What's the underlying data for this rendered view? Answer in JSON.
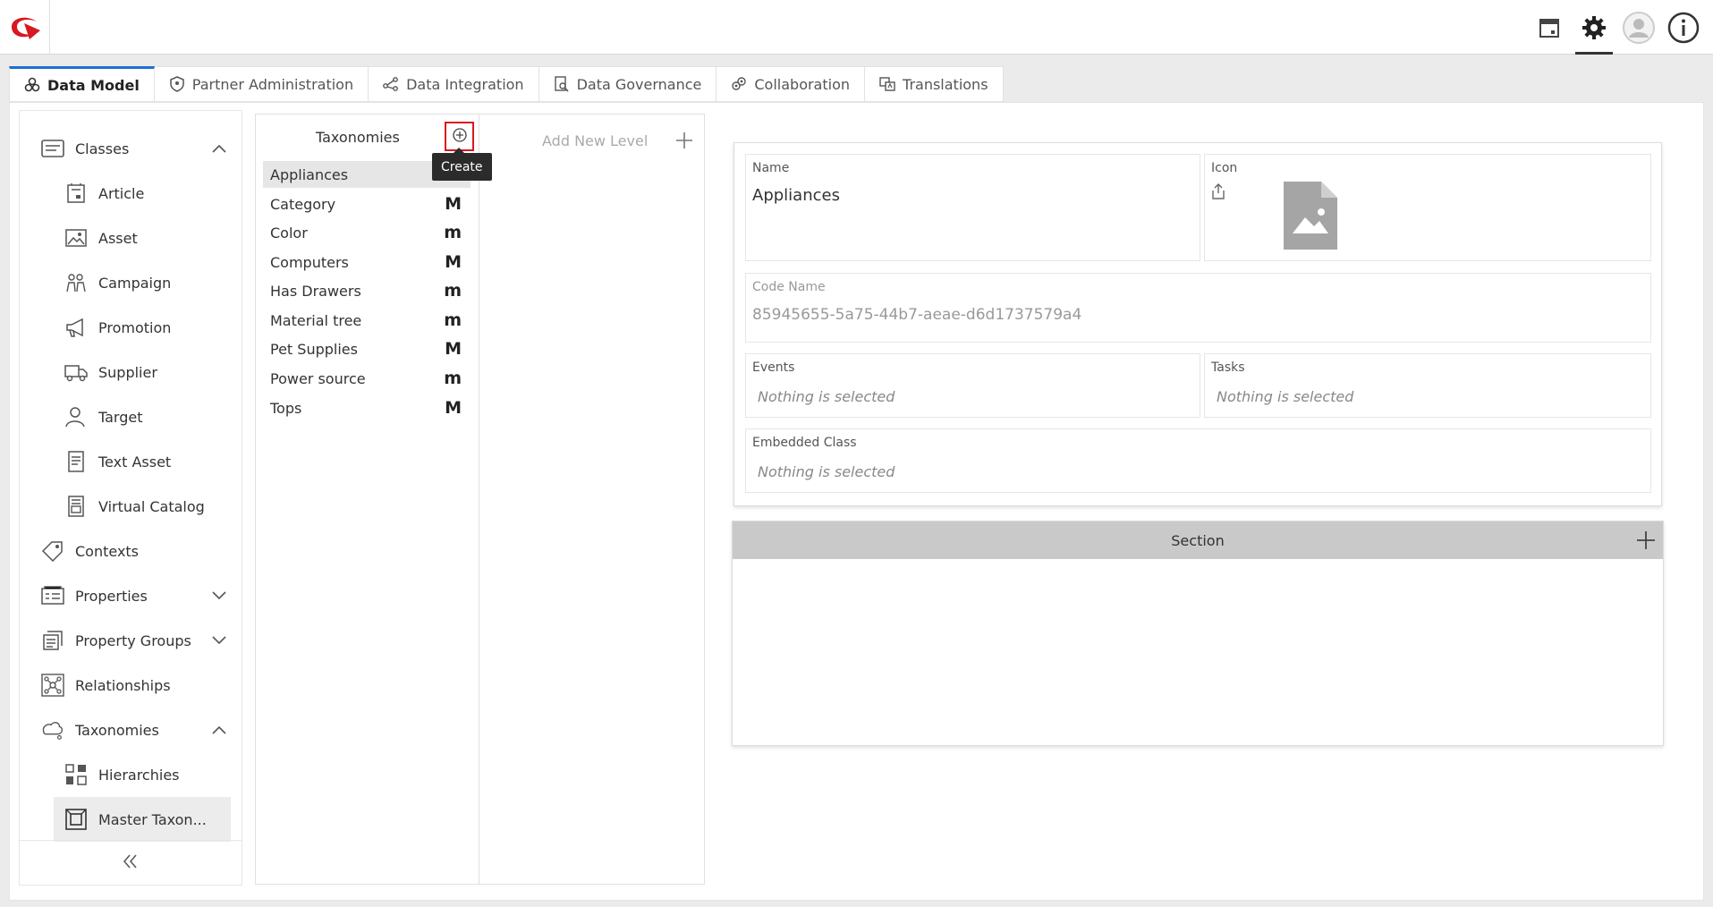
{
  "header": {
    "icons": [
      "logo-icon",
      "calendar-icon",
      "gear-icon",
      "user-avatar-icon",
      "info-icon"
    ]
  },
  "tabs": [
    {
      "label": "Data Model",
      "icon": "data-model-icon",
      "active": true
    },
    {
      "label": "Partner Administration",
      "icon": "shield-icon"
    },
    {
      "label": "Data Integration",
      "icon": "integration-icon"
    },
    {
      "label": "Data Governance",
      "icon": "governance-icon"
    },
    {
      "label": "Collaboration",
      "icon": "collaboration-icon"
    },
    {
      "label": "Translations",
      "icon": "translations-icon"
    }
  ],
  "sidebar": {
    "items": [
      {
        "label": "Classes",
        "icon": "classes-icon",
        "expanded": true
      },
      {
        "label": "Article",
        "icon": "article-icon"
      },
      {
        "label": "Asset",
        "icon": "asset-icon"
      },
      {
        "label": "Campaign",
        "icon": "campaign-icon"
      },
      {
        "label": "Promotion",
        "icon": "megaphone-icon"
      },
      {
        "label": "Supplier",
        "icon": "truck-icon"
      },
      {
        "label": "Target",
        "icon": "target-user-icon"
      },
      {
        "label": "Text Asset",
        "icon": "text-asset-icon"
      },
      {
        "label": "Virtual Catalog",
        "icon": "catalog-icon"
      },
      {
        "label": "Contexts",
        "icon": "tag-icon"
      },
      {
        "label": "Properties",
        "icon": "properties-icon",
        "expanded": false
      },
      {
        "label": "Property Groups",
        "icon": "property-groups-icon",
        "expanded": false
      },
      {
        "label": "Relationships",
        "icon": "relationships-icon"
      },
      {
        "label": "Taxonomies",
        "icon": "taxonomies-icon",
        "expanded": true
      },
      {
        "label": "Hierarchies",
        "icon": "hierarchies-icon"
      },
      {
        "label": "Master Taxon...",
        "icon": "master-taxonomy-icon",
        "selected": true
      }
    ]
  },
  "taxonomies": {
    "title": "Taxonomies",
    "create_tooltip": "Create",
    "rows": [
      {
        "name": "Appliances",
        "badge": "",
        "selected": true
      },
      {
        "name": "Category",
        "badge": "M"
      },
      {
        "name": "Color",
        "badge": "m"
      },
      {
        "name": "Computers",
        "badge": "M"
      },
      {
        "name": "Has Drawers",
        "badge": "m"
      },
      {
        "name": "Material tree",
        "badge": "m"
      },
      {
        "name": "Pet Supplies",
        "badge": "M"
      },
      {
        "name": "Power source",
        "badge": "m"
      },
      {
        "name": "Tops",
        "badge": "M"
      }
    ]
  },
  "levels": {
    "add_label": "Add New Level"
  },
  "details": {
    "name_label": "Name",
    "name_value": "Appliances",
    "icon_label": "Icon",
    "code_label": "Code Name",
    "code_value": "85945655-5a75-44b7-aeae-d6d1737579a4",
    "events_label": "Events",
    "events_placeholder": "Nothing is selected",
    "tasks_label": "Tasks",
    "tasks_placeholder": "Nothing is selected",
    "embedded_label": "Embedded Class",
    "embedded_placeholder": "Nothing is selected"
  },
  "section": {
    "title": "Section"
  },
  "colors": {
    "brand_red": "#d71920",
    "active_tab_blue": "#1f6fd0",
    "section_header": "#c9c9c9"
  }
}
